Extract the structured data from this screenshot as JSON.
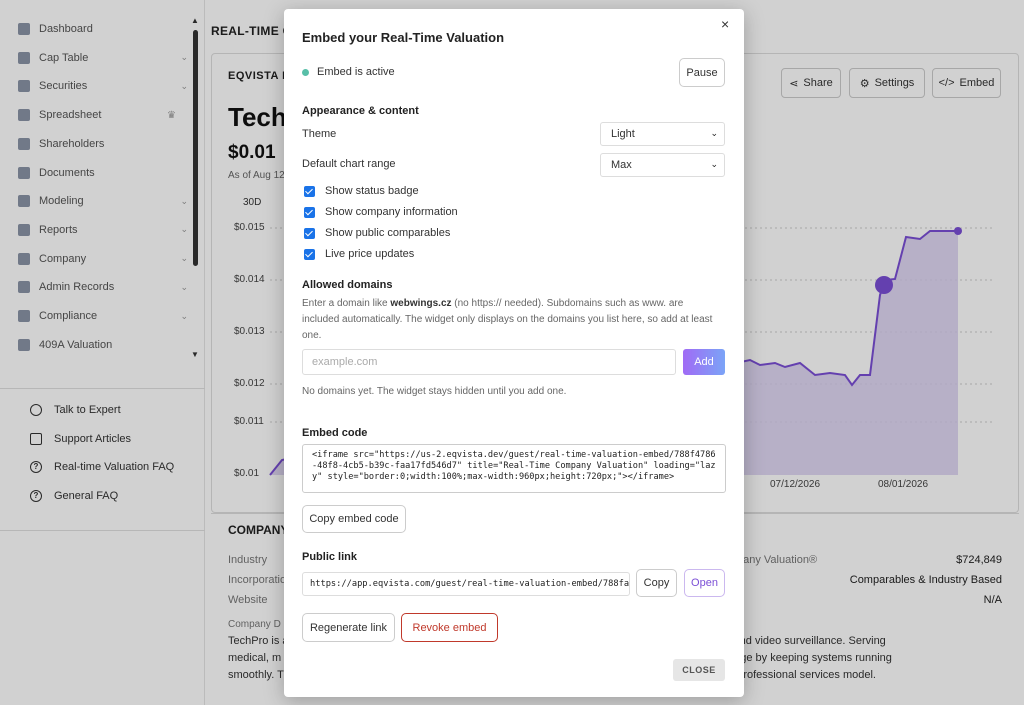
{
  "sidebar": {
    "items": [
      {
        "label": "Dashboard",
        "chev": ""
      },
      {
        "label": "Cap Table",
        "chev": "⌄"
      },
      {
        "label": "Securities",
        "chev": "⌄"
      },
      {
        "label": "Spreadsheet",
        "chev": ""
      },
      {
        "label": "Shareholders",
        "chev": ""
      },
      {
        "label": "Documents",
        "chev": ""
      },
      {
        "label": "Modeling",
        "chev": "⌄"
      },
      {
        "label": "Reports",
        "chev": "⌄"
      },
      {
        "label": "Company",
        "chev": "⌄"
      },
      {
        "label": "Admin Records",
        "chev": "⌄"
      },
      {
        "label": "Compliance",
        "chev": "⌄"
      },
      {
        "label": "409A Valuation",
        "chev": ""
      }
    ],
    "help": [
      {
        "label": "Talk to Expert",
        "icon": "headset-icon"
      },
      {
        "label": "Support Articles",
        "icon": "book-icon"
      },
      {
        "label": "Real-time Valuation FAQ",
        "icon": "help-circle-icon"
      },
      {
        "label": "General FAQ",
        "icon": "help-circle-icon"
      }
    ]
  },
  "main": {
    "title": "REAL-TIME C",
    "card_head": "EQVISTA F",
    "company": "Tech",
    "price": "$0.01",
    "asof": "As of Aug 12",
    "range": "30D",
    "share": "Share",
    "settings": "Settings",
    "embed": "Embed",
    "yticks": [
      "$0.015",
      "$0.014",
      "$0.013",
      "$0.012",
      "$0.011",
      "$0.01"
    ],
    "xticks": [
      "07/12/2026",
      "08/01/2026"
    ],
    "section": "COMPANY",
    "info_labels": [
      "Industry",
      "Incorporatio",
      "Website"
    ],
    "right_label": "pany Valuation®",
    "right_vals": [
      "$724,849",
      "Comparables & Industry Based",
      "N/A"
    ],
    "desc_label": "Company D",
    "desc_lines": [
      "TechPro is a                                                                                                                          n and hosting, and video surveillance. Serving",
      "medical, m                                                                                                                            a competitive edge by keeping systems running",
      "smoothly. T                                                                                                                           pport through a professional services model."
    ]
  },
  "modal": {
    "title": "Embed your Real-Time Valuation",
    "close_x": "×",
    "status": "Embed is active",
    "pause": "Pause",
    "appearance": "Appearance & content",
    "theme_label": "Theme",
    "theme_value": "Light",
    "range_label": "Default chart range",
    "range_value": "Max",
    "checks": [
      "Show status badge",
      "Show company information",
      "Show public comparables",
      "Live price updates"
    ],
    "domains_title": "Allowed domains",
    "help_pre": "Enter a domain like ",
    "help_domain": "webwings.cz",
    "help_post": " (no https:// needed). Subdomains such as www. are included automatically. The widget only displays on the domains you list here, so add at least one.",
    "domain_placeholder": "example.com",
    "add": "Add",
    "no_domains": "No domains yet. The widget stays hidden until you add one.",
    "embed_code_title": "Embed code",
    "embed_code": "<iframe src=\"https://us-2.eqvista.dev/guest/real-time-valuation-embed/788f4786-48f8-4cb5-b39c-faa17fd546d7\" title=\"Real-Time Company Valuation\" loading=\"lazy\" style=\"border:0;width:100%;max-width:960px;height:720px;\"></iframe>",
    "copy_embed": "Copy embed code",
    "public_link_title": "Public link",
    "public_link": "https://app.eqvista.com/guest/real-time-valuation-embed/788fa",
    "copy": "Copy",
    "open": "Open",
    "regenerate": "Regenerate link",
    "revoke": "Revoke embed",
    "close": "CLOSE"
  },
  "colors": {
    "accent": "#7b4fd6",
    "status_active": "#58bfa8",
    "revoke": "#c0392b",
    "checkbox": "#1a73e8"
  }
}
